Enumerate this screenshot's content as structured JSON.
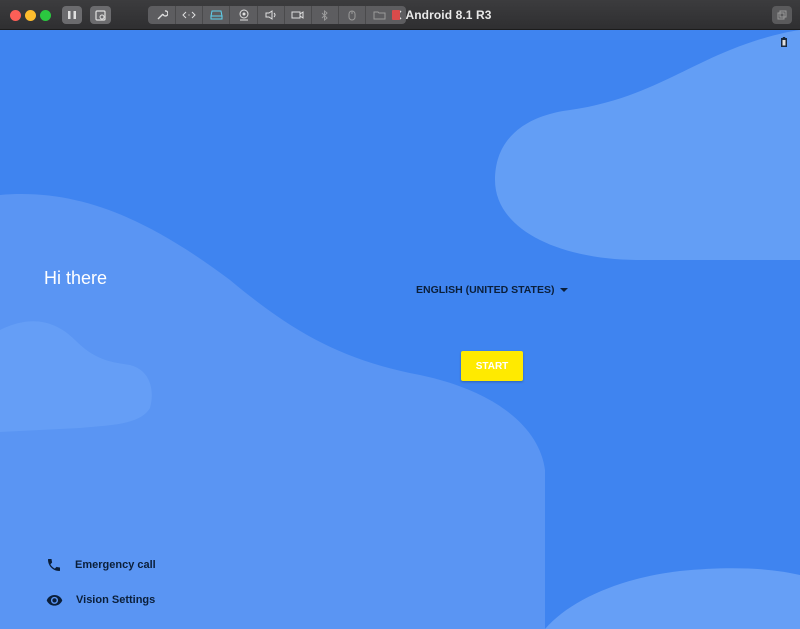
{
  "window": {
    "title": "Android 8.1 R3"
  },
  "toolbar": {
    "icons": [
      "pause-icon",
      "snapshot-icon",
      "wrench-icon",
      "code-icon",
      "hard-drive-icon",
      "camera-icon",
      "speaker-icon",
      "video-icon",
      "bluetooth-icon",
      "mouse-icon",
      "folder-share-icon",
      "chevron-left-icon",
      "window-icon"
    ]
  },
  "setup": {
    "greeting": "Hi there",
    "language": "ENGLISH (UNITED STATES)",
    "start_label": "START",
    "emergency_label": "Emergency call",
    "vision_label": "Vision Settings"
  },
  "colors": {
    "background": "#3f84f0",
    "start_button": "#ffea00",
    "wave_light": "#5b98f4"
  }
}
